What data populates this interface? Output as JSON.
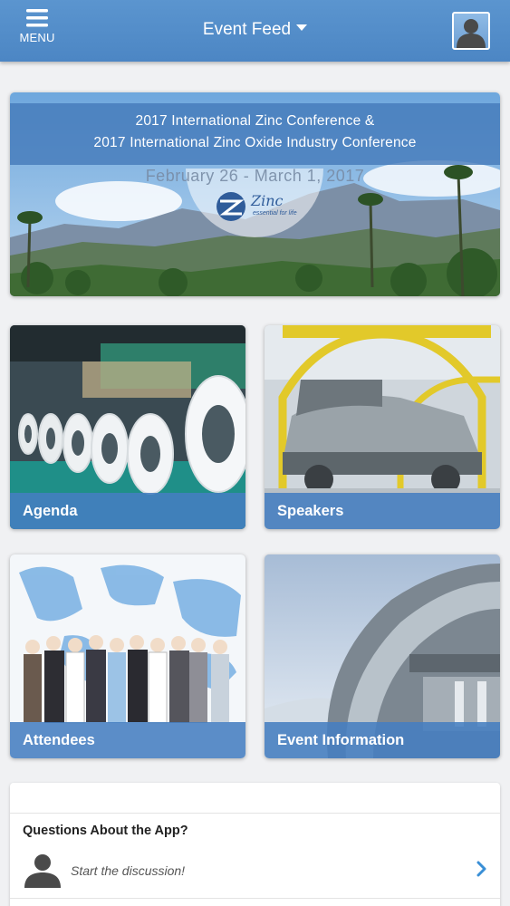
{
  "header": {
    "menu_label": "MENU",
    "title": "Event Feed",
    "menu_icon": "hamburger-icon",
    "title_icon": "caret-down-icon",
    "profile_icon": "user-silhouette-icon"
  },
  "banner": {
    "title_line1": "2017 International Zinc Conference &",
    "title_line2": "2017 International Zinc Oxide Industry Conference",
    "dates": "February 26 - March 1, 2017",
    "logo_word": "Zinc",
    "logo_tagline": "essential for life"
  },
  "tiles": [
    {
      "label": "Agenda"
    },
    {
      "label": "Speakers"
    },
    {
      "label": "Attendees"
    },
    {
      "label": "Event Information"
    }
  ],
  "discussion": {
    "question": "Questions About the App?",
    "prompt": "Start the discussion!",
    "person_icon": "person-icon",
    "chevron_icon": "chevron-right-icon"
  },
  "colors": {
    "accent": "#4c86c4",
    "tile_label_bg": "#467ec0",
    "link_chevron": "#3a8fd6",
    "background": "#f0f1f3"
  }
}
